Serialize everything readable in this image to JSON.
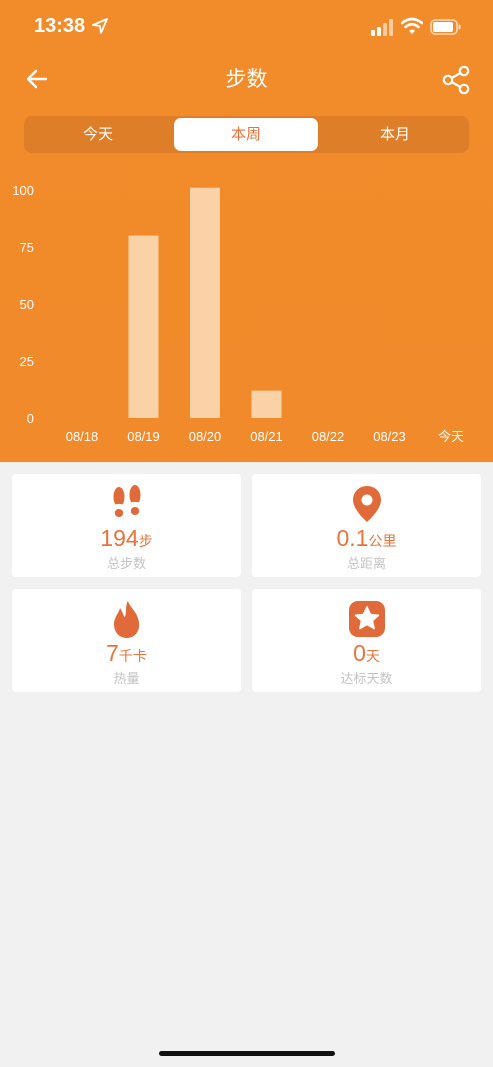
{
  "status_bar": {
    "time": "13:38"
  },
  "header": {
    "title": "步数"
  },
  "tabs": [
    {
      "label": "今天"
    },
    {
      "label": "本周",
      "selected": true
    },
    {
      "label": "本月"
    }
  ],
  "chart_data": {
    "type": "bar",
    "categories": [
      "08/18",
      "08/19",
      "08/20",
      "08/21",
      "08/22",
      "08/23",
      "今天"
    ],
    "values": [
      0,
      80,
      101,
      12,
      0,
      0,
      0
    ],
    "ylim": [
      0,
      100
    ],
    "yticks": [
      0,
      25,
      50,
      75,
      100
    ],
    "ytick_labels": [
      "0",
      "25",
      "50",
      "75",
      "100"
    ],
    "bar_color": "#fbd2a8",
    "background": "#f08a2a",
    "grid": false
  },
  "stats": [
    {
      "value": "194",
      "unit": "步",
      "label": "总步数",
      "icon": "footprints-icon"
    },
    {
      "value": "0.1",
      "unit": "公里",
      "label": "总距离",
      "icon": "location-pin-icon"
    },
    {
      "value": "7",
      "unit": "千卡",
      "label": "热量",
      "icon": "flame-icon"
    },
    {
      "value": "0",
      "unit": "天",
      "label": "达标天数",
      "icon": "star-badge-icon"
    }
  ],
  "colors": {
    "accent": "#e8743b",
    "header_bg": "#f08a2a",
    "icon": "#e06a3a"
  }
}
